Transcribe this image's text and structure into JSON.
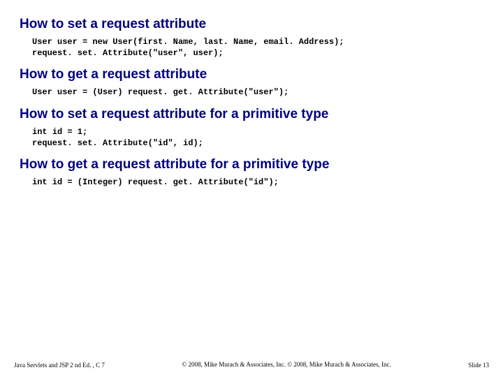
{
  "sections": [
    {
      "heading": "How to set a request attribute",
      "code": "User user = new User(first. Name, last. Name, email. Address);\nrequest. set. Attribute(\"user\", user);"
    },
    {
      "heading": "How to get a request attribute",
      "code": "User user = (User) request. get. Attribute(\"user\");"
    },
    {
      "heading": "How to set a request attribute for a primitive type",
      "code": "int id = 1;\nrequest. set. Attribute(\"id\", id);"
    },
    {
      "heading": "How to get a request attribute for a primitive type",
      "code": "int id = (Integer) request. get. Attribute(\"id\");"
    }
  ],
  "footer": {
    "left": "Java Servlets and JSP 2 nd Ed. , C 7",
    "center": "© 2008, Mike Murach & Associates, Inc. © 2008, Mike\nMurach & Associates, Inc.",
    "right": "Slide 13"
  }
}
